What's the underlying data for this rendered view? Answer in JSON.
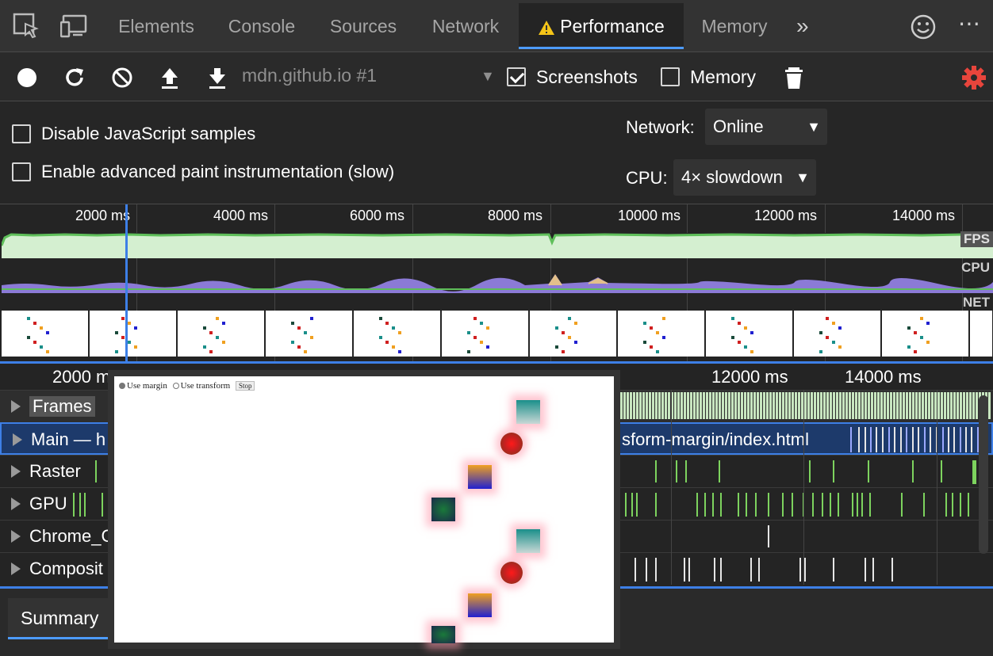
{
  "tabs": {
    "items": [
      "Elements",
      "Console",
      "Sources",
      "Network",
      "Performance",
      "Memory"
    ],
    "active": "Performance",
    "more": "»"
  },
  "toolbar": {
    "profile": "mdn.github.io #1",
    "screenshots_label": "Screenshots",
    "screenshots_checked": true,
    "memory_label": "Memory",
    "memory_checked": false,
    "gear_color": "#e8453c"
  },
  "settings": {
    "disable_js_samples": "Disable JavaScript samples",
    "advanced_paint": "Enable advanced paint instrumentation (slow)",
    "network_label": "Network:",
    "network_value": "Online",
    "cpu_label": "CPU:",
    "cpu_value": "4× slowdown"
  },
  "overview": {
    "ticks": [
      "2000 ms",
      "4000 ms",
      "6000 ms",
      "8000 ms",
      "10000 ms",
      "12000 ms",
      "14000 ms"
    ],
    "fps_label": "FPS",
    "cpu_label": "CPU",
    "net_label": "NET"
  },
  "flame": {
    "ticks": [
      "2000 m",
      "12000 ms",
      "14000 ms"
    ],
    "tracks": [
      {
        "name": "Frames"
      },
      {
        "name": "Main — h",
        "url": "sform-margin/index.html"
      },
      {
        "name": "Raster"
      },
      {
        "name": "GPU"
      },
      {
        "name": "Chrome_C"
      },
      {
        "name": "Composit"
      }
    ]
  },
  "popup": {
    "radio1": "Use margin",
    "radio2": "Use transform",
    "stop": "Stop"
  },
  "bottom": {
    "summary_tab": "Summary"
  },
  "colors": {
    "accent": "#4d9bff",
    "fps_green": "#5fbf5a",
    "track_green": "#7dd35e",
    "frame_bar": "#c8e6c0"
  }
}
